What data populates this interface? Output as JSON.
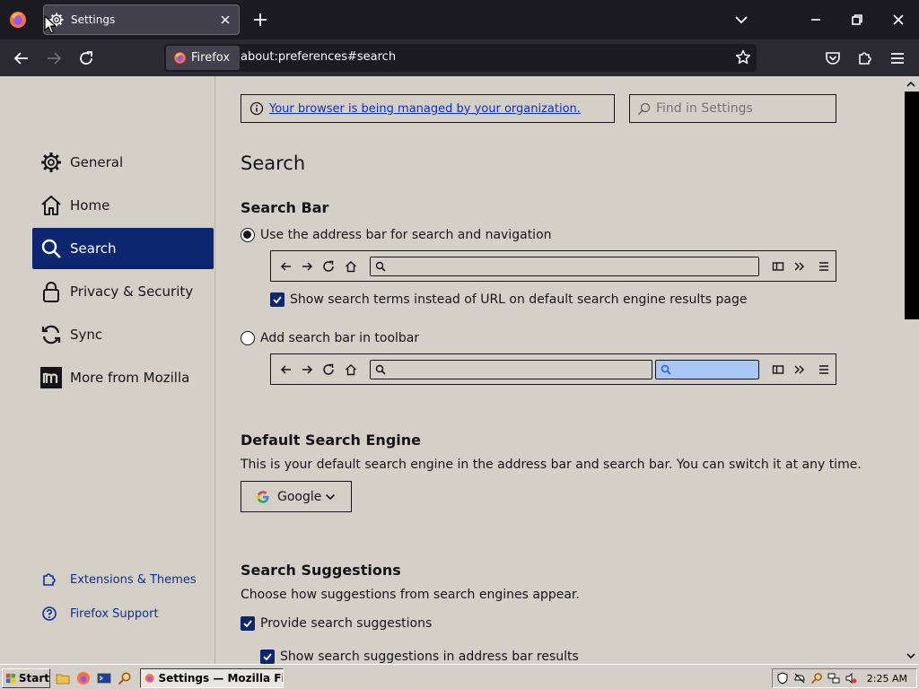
{
  "browser": {
    "tab_title": "Settings",
    "identity_label": "Firefox",
    "url": "about:preferences#search"
  },
  "sidebar": {
    "categories": [
      {
        "label": "General",
        "icon": "gear-icon"
      },
      {
        "label": "Home",
        "icon": "home-icon"
      },
      {
        "label": "Search",
        "icon": "search-icon",
        "selected": true
      },
      {
        "label": "Privacy & Security",
        "icon": "lock-icon"
      },
      {
        "label": "Sync",
        "icon": "sync-icon"
      },
      {
        "label": "More from Mozilla",
        "icon": "mozilla-icon"
      }
    ],
    "footer_links": [
      {
        "label": "Extensions & Themes",
        "icon": "puzzle-icon"
      },
      {
        "label": "Firefox Support",
        "icon": "help-icon"
      }
    ]
  },
  "main": {
    "policy_notice": "Your browser is being managed by your organization.",
    "find_placeholder": "Find in Settings",
    "page_title": "Search",
    "search_bar": {
      "heading": "Search Bar",
      "option_address": "Use the address bar for search and navigation",
      "option_address_selected": true,
      "show_terms": "Show search terms instead of URL on default search engine results page",
      "show_terms_checked": true,
      "option_toolbar": "Add search bar in toolbar",
      "option_toolbar_selected": false
    },
    "default_engine": {
      "heading": "Default Search Engine",
      "description": "This is your default search engine in the address bar and search bar. You can switch it at any time.",
      "selected": "Google"
    },
    "suggestions": {
      "heading": "Search Suggestions",
      "description": "Choose how suggestions from search engines appear.",
      "provide": "Provide search suggestions",
      "provide_checked": true,
      "address_bar_results": "Show search suggestions in address bar results",
      "address_bar_results_checked": true
    }
  },
  "taskbar": {
    "start_label": "Start",
    "task_label": "Settings — Mozilla Fire...",
    "clock": "2:25 AM"
  },
  "colors": {
    "selected_category": "#0c2670",
    "content_bg": "#d4d0c8",
    "link": "#0a2fd6"
  }
}
